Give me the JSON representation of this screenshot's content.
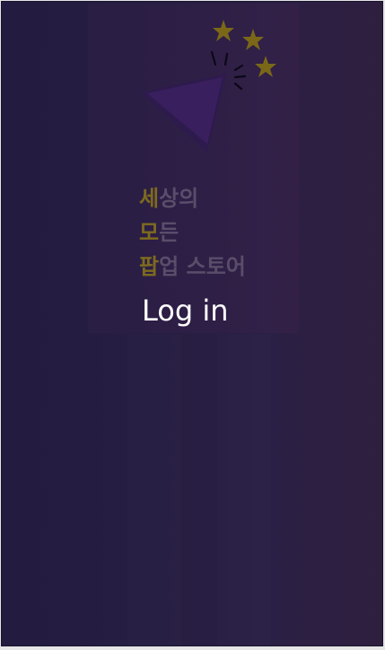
{
  "slogan": {
    "line1": {
      "highlight": "세",
      "rest": "상의"
    },
    "line2": {
      "highlight": "모",
      "rest": "든"
    },
    "line3": {
      "highlight": "팝",
      "rest": "업 스토어"
    }
  },
  "login": {
    "label": "Log in"
  },
  "colors": {
    "background": "#261d42",
    "highlight": "#7d6a1f",
    "slogan_text": "#5a4d6a",
    "star": "#7a6818",
    "triangle": "#3a1f5e",
    "login_text": "#ffffff"
  },
  "icons": [
    "star-icon",
    "popper-cone-icon",
    "burst-lines-icon"
  ]
}
